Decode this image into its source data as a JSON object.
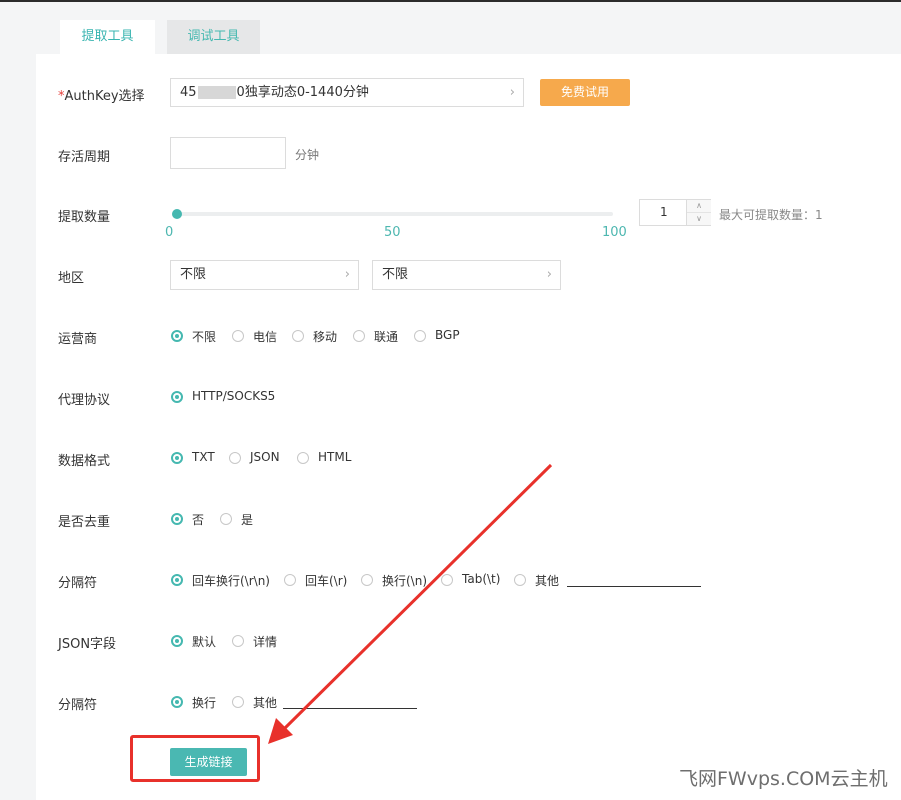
{
  "tabs": [
    {
      "label": "提取工具",
      "active": true
    },
    {
      "label": "调试工具",
      "active": false
    }
  ],
  "authkey": {
    "required_mark": "*",
    "label": "AuthKey选择",
    "value_prefix": "45",
    "value_suffix": "0独享动态0-1440分钟",
    "trial_button": "免费试用"
  },
  "lifetime": {
    "label": "存活周期",
    "value": "",
    "unit": "分钟"
  },
  "quantity": {
    "label": "提取数量",
    "slider_min": 0,
    "slider_mid": 50,
    "slider_max": 100,
    "slider_value": 1,
    "tick_min": "0",
    "tick_mid": "50",
    "tick_max": "100",
    "input_value": "1",
    "max_label": "最大可提取数量：1"
  },
  "region": {
    "label": "地区",
    "select1": "不限",
    "select2": "不限"
  },
  "isp": {
    "label": "运营商",
    "options": [
      "不限",
      "电信",
      "移动",
      "联通",
      "BGP"
    ],
    "selected": 0
  },
  "protocol": {
    "label": "代理协议",
    "options": [
      "HTTP/SOCKS5"
    ],
    "selected": 0
  },
  "format": {
    "label": "数据格式",
    "options": [
      "TXT",
      "JSON",
      "HTML"
    ],
    "selected": 0
  },
  "dedupe": {
    "label": "是否去重",
    "options": [
      "否",
      "是"
    ],
    "selected": 0
  },
  "separator": {
    "label": "分隔符",
    "options": [
      "回车换行(\\r\\n)",
      "回车(\\r)",
      "换行(\\n)",
      "Tab(\\t)",
      "其他"
    ],
    "selected": 0
  },
  "json_field": {
    "label": "JSON字段",
    "options": [
      "默认",
      "详情"
    ],
    "selected": 0
  },
  "separator2": {
    "label": "分隔符",
    "options": [
      "换行",
      "其他"
    ],
    "selected": 0
  },
  "generate_button": "生成链接",
  "watermark": "飞网FWvps.COM云主机",
  "colors": {
    "accent": "#45b8b0",
    "orange": "#f6a94c",
    "annotation_red": "#e8312b"
  }
}
